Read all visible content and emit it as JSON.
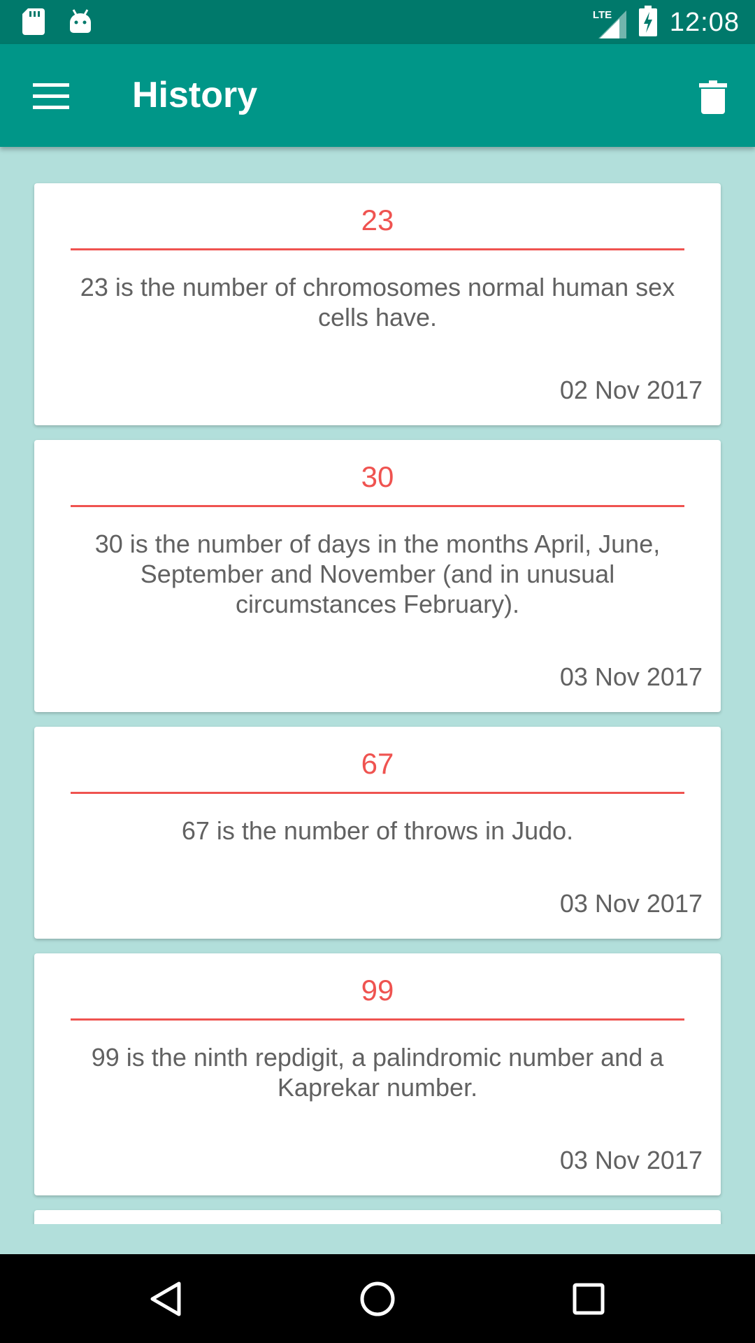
{
  "status_bar": {
    "time": "12:08",
    "network_label": "LTE",
    "icons": [
      "sd-card-icon",
      "android-icon",
      "lte-signal-icon",
      "battery-charging-icon"
    ]
  },
  "app_bar": {
    "title": "History",
    "menu_icon": "hamburger-menu-icon",
    "delete_icon": "trash-icon"
  },
  "history": {
    "items": [
      {
        "number": "23",
        "fact": "23 is the number of chromosomes normal human sex cells have.",
        "date": "02 Nov 2017"
      },
      {
        "number": "30",
        "fact": "30 is the number of days in the months April, June, September and November (and in unusual circumstances February).",
        "date": "03 Nov 2017"
      },
      {
        "number": "67",
        "fact": "67 is the number of throws in Judo.",
        "date": "03 Nov 2017"
      },
      {
        "number": "99",
        "fact": "99 is the ninth repdigit, a palindromic number and a Kaprekar number.",
        "date": "03 Nov 2017"
      }
    ]
  },
  "nav_bar": {
    "icons": [
      "back-icon",
      "home-icon",
      "recents-icon"
    ]
  },
  "colors": {
    "status_bar": "#00796b",
    "app_bar": "#009688",
    "background": "#b2dfdb",
    "accent": "#ef5350",
    "body_text": "#616161"
  }
}
